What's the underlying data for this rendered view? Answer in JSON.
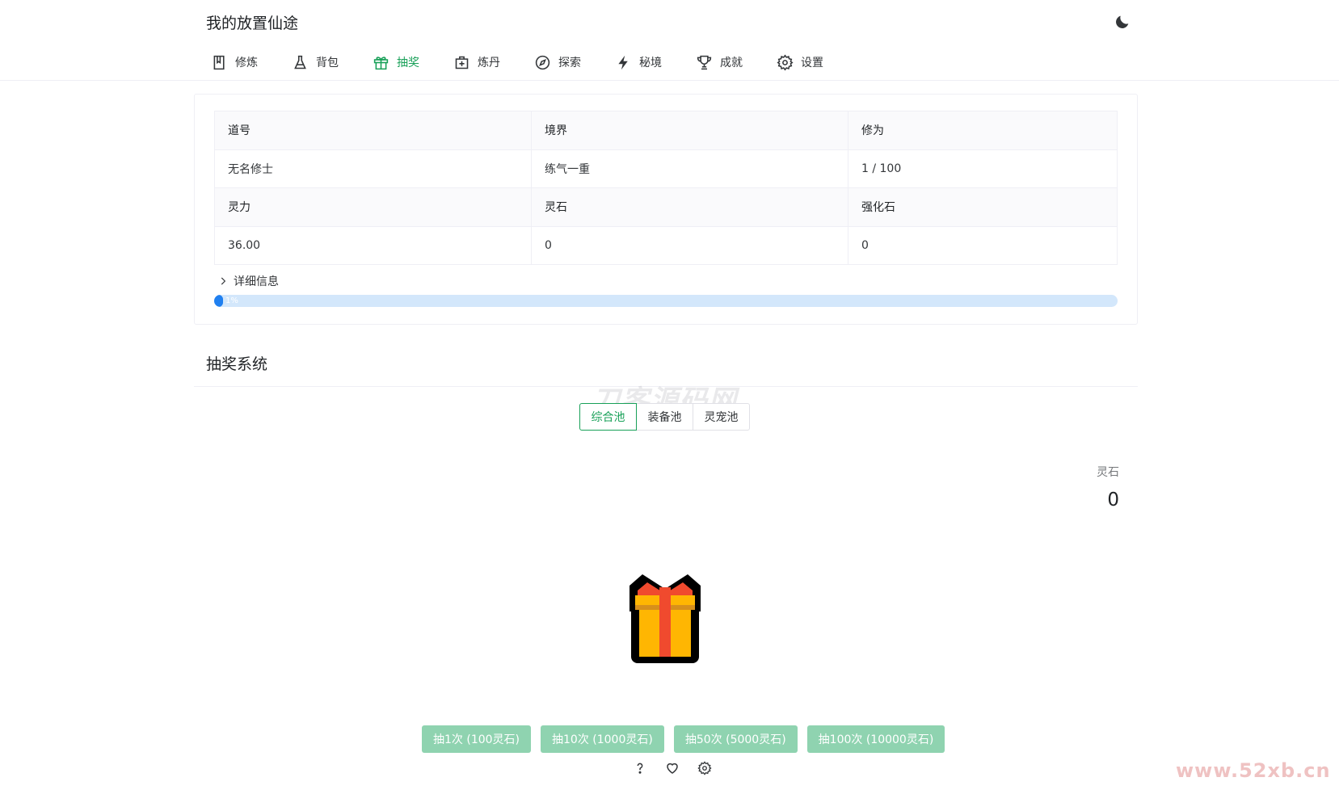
{
  "app": {
    "title": "我的放置仙途"
  },
  "nav": {
    "items": [
      {
        "label": "修炼"
      },
      {
        "label": "背包"
      },
      {
        "label": "抽奖"
      },
      {
        "label": "炼丹"
      },
      {
        "label": "探索"
      },
      {
        "label": "秘境"
      },
      {
        "label": "成就"
      },
      {
        "label": "设置"
      }
    ],
    "active_index": 2
  },
  "player": {
    "rows": [
      [
        "道号",
        "境界",
        "修为"
      ],
      [
        "无名修士",
        "练气一重",
        "1 / 100"
      ],
      [
        "灵力",
        "灵石",
        "强化石"
      ],
      [
        "36.00",
        "0",
        "0"
      ]
    ],
    "detail_label": "详细信息",
    "progress_percent": 1,
    "progress_label": "1%"
  },
  "gacha": {
    "section_title": "抽奖系统",
    "tabs": [
      "综合池",
      "装备池",
      "灵宠池"
    ],
    "active_tab": 0,
    "currency_label": "灵石",
    "currency_value": "0",
    "buttons": [
      "抽1次 (100灵石)",
      "抽10次 (1000灵石)",
      "抽50次 (5000灵石)",
      "抽100次 (10000灵石)"
    ],
    "footer_icons": [
      "help-icon",
      "heart-icon",
      "gear-icon"
    ]
  },
  "watermarks": {
    "center": "刀客源码网",
    "corner": "www.52xb.cn"
  },
  "colors": {
    "accent": "#18a058",
    "progress": "#2080f0",
    "progress_track": "#d3e7fb",
    "button": "#8fd3b0"
  }
}
